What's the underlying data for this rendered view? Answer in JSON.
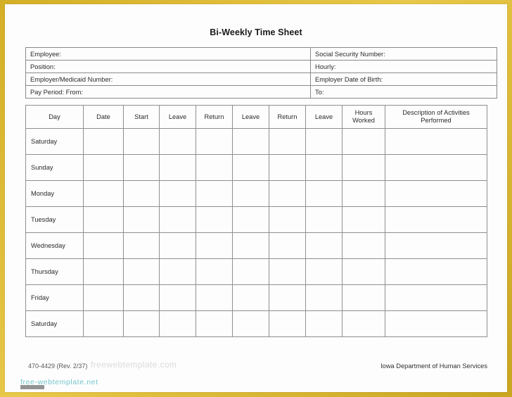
{
  "document": {
    "title": "Bi-Weekly Time Sheet"
  },
  "info_block": {
    "rows": [
      {
        "left": "Employee:",
        "right": "Social Security Number:"
      },
      {
        "left": "Position:",
        "right": "Hourly:"
      },
      {
        "left": "Employer/Medicaid Number:",
        "right": "Employer Date of Birth:"
      },
      {
        "left": "Pay Period:  From:",
        "right": "To:"
      }
    ]
  },
  "timesheet": {
    "columns": [
      "Day",
      "Date",
      "Start",
      "Leave",
      "Return",
      "Leave",
      "Return",
      "Leave",
      "Hours Worked",
      "Description of Activities Performed"
    ],
    "columns_multiline": [
      "Day",
      "Date",
      "Start",
      "Leave",
      "Return",
      "Leave",
      "Return",
      "Leave",
      "Hours\nWorked",
      "Description of Activities\nPerformed"
    ],
    "rows": [
      {
        "day": "Saturday",
        "date": "",
        "start": "",
        "leave1": "",
        "return1": "",
        "leave2": "",
        "return2": "",
        "leave3": "",
        "hours": "",
        "description": ""
      },
      {
        "day": "Sunday",
        "date": "",
        "start": "",
        "leave1": "",
        "return1": "",
        "leave2": "",
        "return2": "",
        "leave3": "",
        "hours": "",
        "description": ""
      },
      {
        "day": "Monday",
        "date": "",
        "start": "",
        "leave1": "",
        "return1": "",
        "leave2": "",
        "return2": "",
        "leave3": "",
        "hours": "",
        "description": ""
      },
      {
        "day": "Tuesday",
        "date": "",
        "start": "",
        "leave1": "",
        "return1": "",
        "leave2": "",
        "return2": "",
        "leave3": "",
        "hours": "",
        "description": ""
      },
      {
        "day": "Wednesday",
        "date": "",
        "start": "",
        "leave1": "",
        "return1": "",
        "leave2": "",
        "return2": "",
        "leave3": "",
        "hours": "",
        "description": ""
      },
      {
        "day": "Thursday",
        "date": "",
        "start": "",
        "leave1": "",
        "return1": "",
        "leave2": "",
        "return2": "",
        "leave3": "",
        "hours": "",
        "description": ""
      },
      {
        "day": "Friday",
        "date": "",
        "start": "",
        "leave1": "",
        "return1": "",
        "leave2": "",
        "return2": "",
        "leave3": "",
        "hours": "",
        "description": ""
      },
      {
        "day": "Saturday",
        "date": "",
        "start": "",
        "leave1": "",
        "return1": "",
        "leave2": "",
        "return2": "",
        "leave3": "",
        "hours": "",
        "description": ""
      }
    ]
  },
  "footer": {
    "form_number": "470-4429  (Rev. 2/37)",
    "agency": "Iowa Department of Human Services"
  },
  "watermarks": {
    "diagonal_text": "freewebtemplate.com",
    "site_text": "free-webtemplate.net"
  },
  "colors": {
    "frame": "#d4af26",
    "page": "#fdfdfd",
    "grid_line": "#8f8f8f",
    "text": "#2a2a2a",
    "watermark_teal": "#0098a3"
  }
}
